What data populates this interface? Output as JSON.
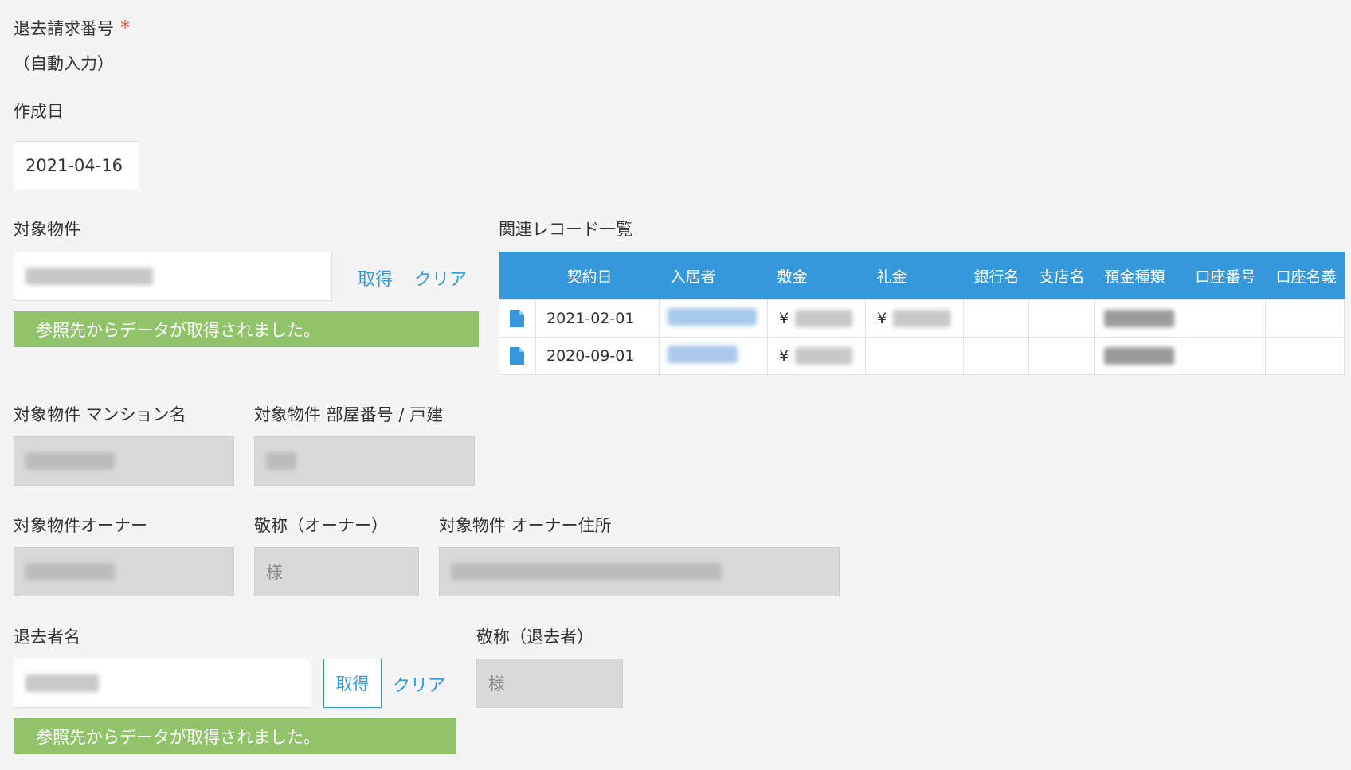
{
  "withdrawal_number": {
    "label": "退去請求番号",
    "required_mark": "*",
    "value": "（自動入力）"
  },
  "created_date": {
    "label": "作成日",
    "value": "2021-04-16"
  },
  "property": {
    "label": "対象物件",
    "get_label": "取得",
    "clear_label": "クリア",
    "success_message": "参照先からデータが取得されました。"
  },
  "related_records": {
    "label": "関連レコード一覧",
    "columns": [
      "契約日",
      "入居者",
      "敷金",
      "礼金",
      "銀行名",
      "支店名",
      "預金種類",
      "口座番号",
      "口座名義"
    ],
    "rows": [
      {
        "date": "2021-02-01",
        "deposit_currency": "¥",
        "key_money_currency": "¥"
      },
      {
        "date": "2020-09-01",
        "deposit_currency": "¥",
        "key_money_currency": ""
      }
    ]
  },
  "mansion_name": {
    "label": "対象物件 マンション名"
  },
  "room_number": {
    "label": "対象物件 部屋番号 / 戸建"
  },
  "owner": {
    "label": "対象物件オーナー"
  },
  "owner_honorific": {
    "label": "敬称（オーナー）",
    "value": "様"
  },
  "owner_address": {
    "label": "対象物件 オーナー住所"
  },
  "leaver": {
    "label": "退去者名",
    "get_label": "取得",
    "clear_label": "クリア",
    "success_message": "参照先からデータが取得されました。"
  },
  "leaver_honorific": {
    "label": "敬称（退去者）",
    "value": "様"
  },
  "colors": {
    "accent": "#3498db",
    "success": "#91c36a",
    "required": "#e74c3c"
  }
}
